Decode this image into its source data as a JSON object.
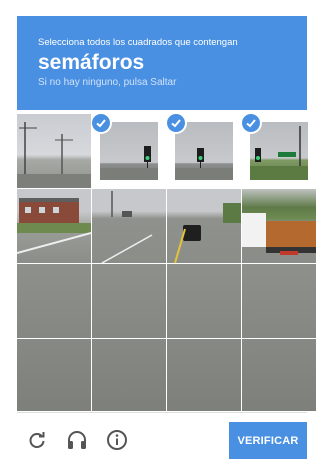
{
  "challenge": {
    "instruction": "Selecciona todos los cuadrados que contengan",
    "target": "semáforos",
    "hint": "Si no hay ninguno, pulsa Saltar",
    "accent_color": "#4a90e2"
  },
  "grid": {
    "rows": 4,
    "columns": 4,
    "selected_tiles": [
      2,
      3,
      4
    ]
  },
  "footer": {
    "reload_icon": "reload-icon",
    "audio_icon": "headphones-icon",
    "info_icon": "info-icon",
    "verify_label": "VERIFICAR"
  }
}
